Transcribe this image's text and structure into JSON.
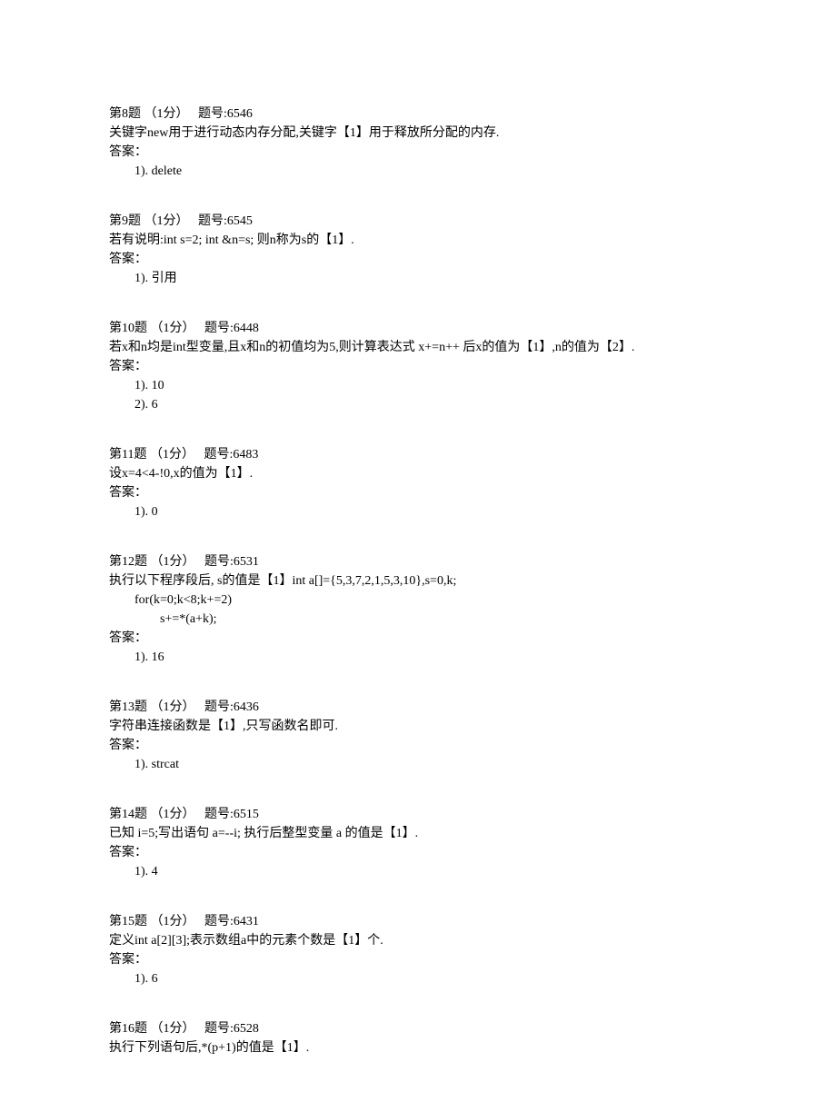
{
  "questions": [
    {
      "header": "第8题 （1分）   题号:6546",
      "body_lines": [
        "关键字new用于进行动态内存分配,关键字【1】用于释放所分配的内存."
      ],
      "answer_label": "答案：",
      "answers": [
        "1). delete"
      ]
    },
    {
      "header": "第9题 （1分）   题号:6545",
      "body_lines": [
        "若有说明:int s=2; int &n=s; 则n称为s的【1】."
      ],
      "answer_label": "答案：",
      "answers": [
        "1). 引用"
      ]
    },
    {
      "header": "第10题 （1分）   题号:6448",
      "body_lines": [
        "若x和n均是int型变量,且x和n的初值均为5,则计算表达式 x+=n++ 后x的值为【1】,n的值为【2】."
      ],
      "answer_label": "答案：",
      "answers": [
        "1). 10",
        "2). 6"
      ]
    },
    {
      "header": "第11题 （1分）   题号:6483",
      "body_lines": [
        "设x=4<4-!0,x的值为【1】."
      ],
      "answer_label": "答案：",
      "answers": [
        "1). 0"
      ]
    },
    {
      "header": "第12题 （1分）   题号:6531",
      "body_lines": [
        "执行以下程序段后, s的值是【1】int a[]={5,3,7,2,1,5,3,10},s=0,k;"
      ],
      "code_lines": [
        {
          "indent": 1,
          "text": "for(k=0;k<8;k+=2)"
        },
        {
          "indent": 2,
          "text": "s+=*(a+k);"
        }
      ],
      "answer_label": "答案：",
      "answers": [
        "1). 16"
      ]
    },
    {
      "header": "第13题 （1分）   题号:6436",
      "body_lines": [
        "字符串连接函数是【1】,只写函数名即可."
      ],
      "answer_label": "答案：",
      "answers": [
        "1). strcat"
      ]
    },
    {
      "header": "第14题 （1分）   题号:6515",
      "body_lines": [
        "已知 i=5;写出语句 a=--i; 执行后整型变量 a 的值是【1】."
      ],
      "answer_label": "答案：",
      "answers": [
        "1). 4"
      ]
    },
    {
      "header": "第15题 （1分）   题号:6431",
      "body_lines": [
        "定义int a[2][3];表示数组a中的元素个数是【1】个."
      ],
      "answer_label": "答案：",
      "answers": [
        "1). 6"
      ]
    },
    {
      "header": "第16题 （1分）   题号:6528",
      "body_lines": [
        "执行下列语句后,*(p+1)的值是【1】."
      ],
      "answer_label": "",
      "answers": []
    }
  ]
}
